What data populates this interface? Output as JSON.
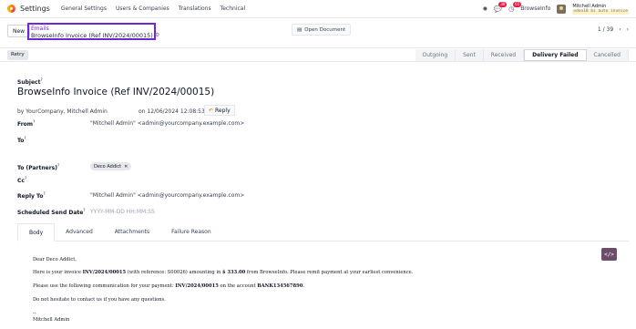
{
  "navbar": {
    "app_name": "Settings",
    "menu": [
      "General Settings",
      "Users & Companies",
      "Translations",
      "Technical"
    ],
    "bug_icon": "bug-icon",
    "messages_badge": "38",
    "activity_badge": "65",
    "company": "BrowseInfo",
    "user_name": "Mitchell Admin",
    "user_db": "odoo18 bi auto invoice"
  },
  "control": {
    "new_label": "New",
    "breadcrumb_parent": "Emails",
    "breadcrumb_current": "BrowseInfo Invoice (Ref INV/2024/00015)",
    "open_document_label": "Open Document",
    "pager": "1 / 39"
  },
  "statusbar": {
    "retry_label": "Retry",
    "stages": [
      "Outgoing",
      "Sent",
      "Received",
      "Delivery Failed",
      "Cancelled"
    ],
    "active_stage": "Delivery Failed"
  },
  "form": {
    "subject_label": "Subject",
    "subject_value": "BrowseInfo Invoice (Ref INV/2024/00015)",
    "author_line": "by YourCompany, Mitchell Admin",
    "date_line": "on 12/06/2024 12:08:53",
    "reply_label": "Reply",
    "from_label": "From",
    "from_value": "\"Mitchell Admin\" <admin@yourcompany.example.com>",
    "to_label": "To",
    "to_partners_label": "To (Partners)",
    "to_partners_tag": "Deco Addict",
    "cc_label": "Cc",
    "reply_to_label": "Reply To",
    "reply_to_value": "\"Mitchell Admin\" <admin@yourcompany.example.com>",
    "scheduled_label": "Scheduled Send Date",
    "scheduled_placeholder": "YYYY-MM-DD HH:MM:SS"
  },
  "tabs": [
    "Body",
    "Advanced",
    "Attachments",
    "Failure Reason"
  ],
  "body": {
    "greeting": "Dear Deco Addict,",
    "line1_a": "Here is your invoice ",
    "line1_b": "INV/2024/00015",
    "line1_c": " (with reference: S00026) amounting in ",
    "line1_d": "$ 333.00",
    "line1_e": " from BrowseInfo. Please remit payment at your earliest convenience.",
    "line2_a": "Please use the following communication for your payment: ",
    "line2_b": "INV/2024/00015",
    "line2_c": " on the account ",
    "line2_d": "BANK134567890",
    "line2_e": ".",
    "line3": "Do not hesitate to contact us if you have any questions.",
    "sig_dash": "--",
    "signature": "Mitchell Admin"
  }
}
